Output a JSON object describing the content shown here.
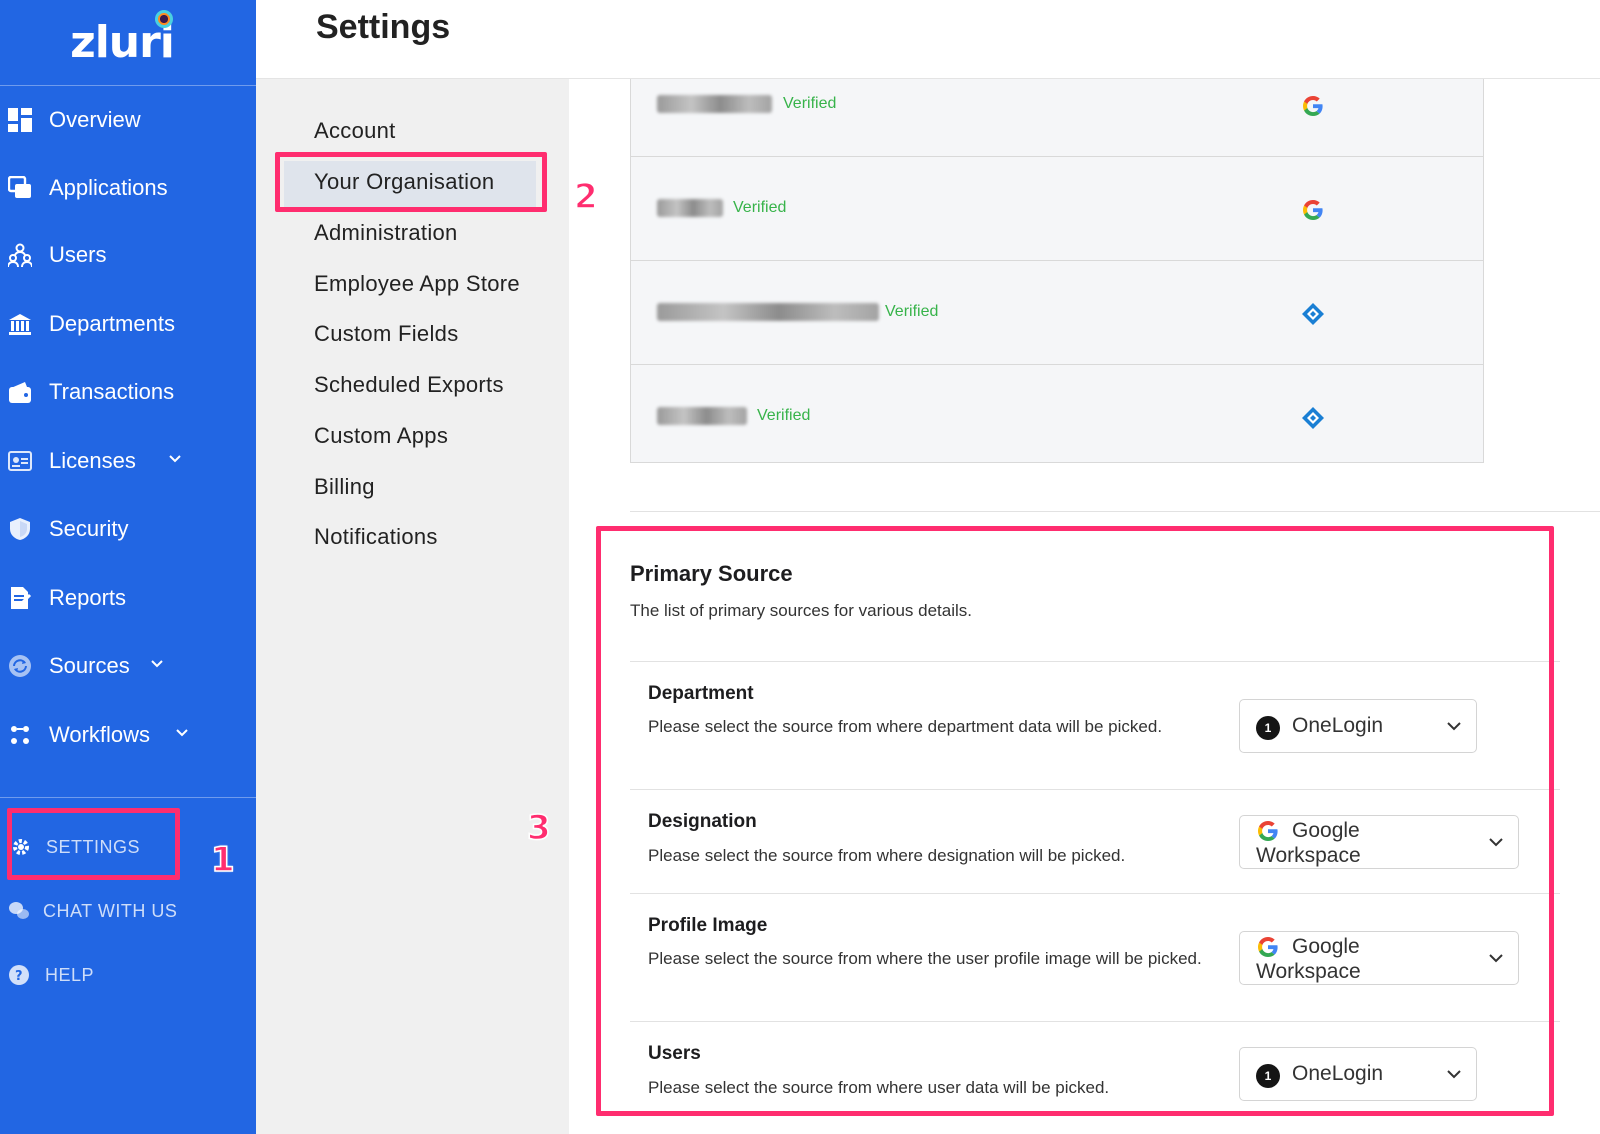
{
  "app": {
    "logo_text": "zluri"
  },
  "page": {
    "title": "Settings"
  },
  "sidebar": {
    "items": [
      {
        "label": "Overview",
        "icon": "dashboard-icon",
        "dropdown": false
      },
      {
        "label": "Applications",
        "icon": "applications-icon",
        "dropdown": false
      },
      {
        "label": "Users",
        "icon": "users-icon",
        "dropdown": false
      },
      {
        "label": "Departments",
        "icon": "building-icon",
        "dropdown": false
      },
      {
        "label": "Transactions",
        "icon": "wallet-icon",
        "dropdown": false
      },
      {
        "label": "Licenses",
        "icon": "license-card-icon",
        "dropdown": true
      },
      {
        "label": "Security",
        "icon": "shield-icon",
        "dropdown": false
      },
      {
        "label": "Reports",
        "icon": "report-icon",
        "dropdown": false
      },
      {
        "label": "Sources",
        "icon": "sources-icon",
        "dropdown": true
      },
      {
        "label": "Workflows",
        "icon": "workflow-icon",
        "dropdown": true
      }
    ],
    "bottom": [
      {
        "label": "SETTINGS",
        "icon": "gear-icon"
      },
      {
        "label": "CHAT WITH US",
        "icon": "chat-icon"
      },
      {
        "label": "HELP",
        "icon": "help-icon"
      }
    ]
  },
  "settings_menu": {
    "items": [
      "Account",
      "Your Organisation",
      "Administration",
      "Employee App Store",
      "Custom Fields",
      "Scheduled Exports",
      "Custom Apps",
      "Billing",
      "Notifications"
    ],
    "active": "Your Organisation"
  },
  "domains": [
    {
      "status": "Verified",
      "provider_icon": "google-icon"
    },
    {
      "status": "Verified",
      "provider_icon": "google-icon"
    },
    {
      "status": "Verified",
      "provider_icon": "onelogin-diamond-icon"
    },
    {
      "status": "Verified",
      "provider_icon": "onelogin-diamond-icon"
    }
  ],
  "primary_source": {
    "title": "Primary Source",
    "description": "The list of primary sources for various details.",
    "rows": [
      {
        "label": "Department",
        "help": "Please select the source from where department data will be picked.",
        "source": "OneLogin",
        "source_icon": "onelogin-icon"
      },
      {
        "label": "Designation",
        "help": "Please select the source from where designation will be picked.",
        "source": "Google Workspace",
        "source_icon": "google-icon"
      },
      {
        "label": "Profile Image",
        "help": "Please select the source from where the user profile image will be picked.",
        "source": "Google Workspace",
        "source_icon": "google-icon"
      },
      {
        "label": "Users",
        "help": "Please select the source from where user data will be picked.",
        "source": "OneLogin",
        "source_icon": "onelogin-icon"
      }
    ]
  },
  "annotations": {
    "step1": "1",
    "step2": "2",
    "step3": "3"
  },
  "colors": {
    "sidebar": "#2266e3",
    "highlight": "#ff2d6f",
    "verified": "#37b34a",
    "onelogin_diamond": "#1a7fd4"
  }
}
